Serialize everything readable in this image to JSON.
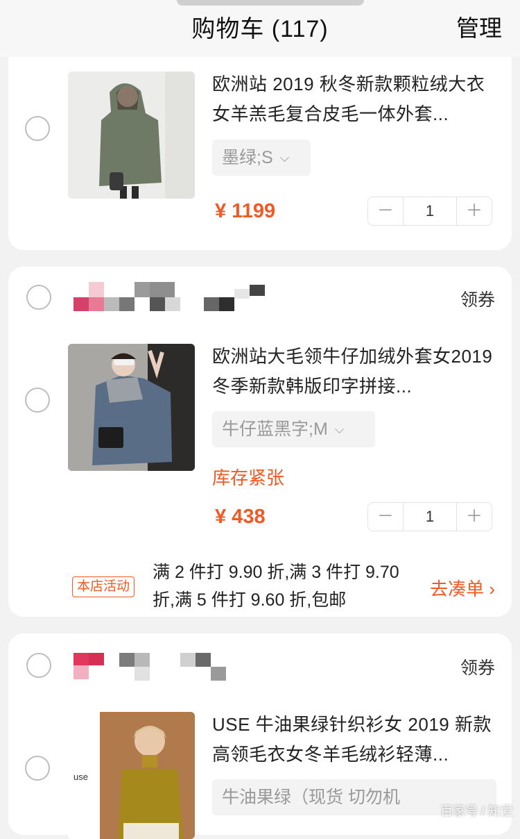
{
  "header": {
    "title": "购物车 (117)",
    "manage_label": "管理"
  },
  "items": [
    {
      "title": "欧洲站 2019 秋冬新款颗粒绒大衣女羊羔毛复合皮毛一体外套...",
      "sku": "墨绿;S",
      "price": "¥ 1199",
      "quantity": "1"
    },
    {
      "title": "欧洲站大毛领牛仔加绒外套女2019 冬季新款韩版印字拼接...",
      "sku": "牛仔蓝黑字;M",
      "stock_notice": "库存紧张",
      "price": "¥ 438",
      "quantity": "1"
    },
    {
      "title": "USE 牛油果绿针织衫女 2019 新款高领毛衣女冬羊毛绒衫轻薄...",
      "sku": "牛油果绿（现货 切勿机",
      "brand_text": "use"
    }
  ],
  "shops": [
    {
      "coupon_label": "领券"
    },
    {
      "coupon_label": "领券"
    }
  ],
  "promo": {
    "tag": "本店活动",
    "text": "满 2 件打 9.90 折,满 3 件打 9.70 折,满 5 件打 9.60 折,包邮",
    "action": "去凑单 ›"
  },
  "stepper": {
    "minus": "－",
    "plus": "＋"
  },
  "watermark": "百家号 / 知爱"
}
